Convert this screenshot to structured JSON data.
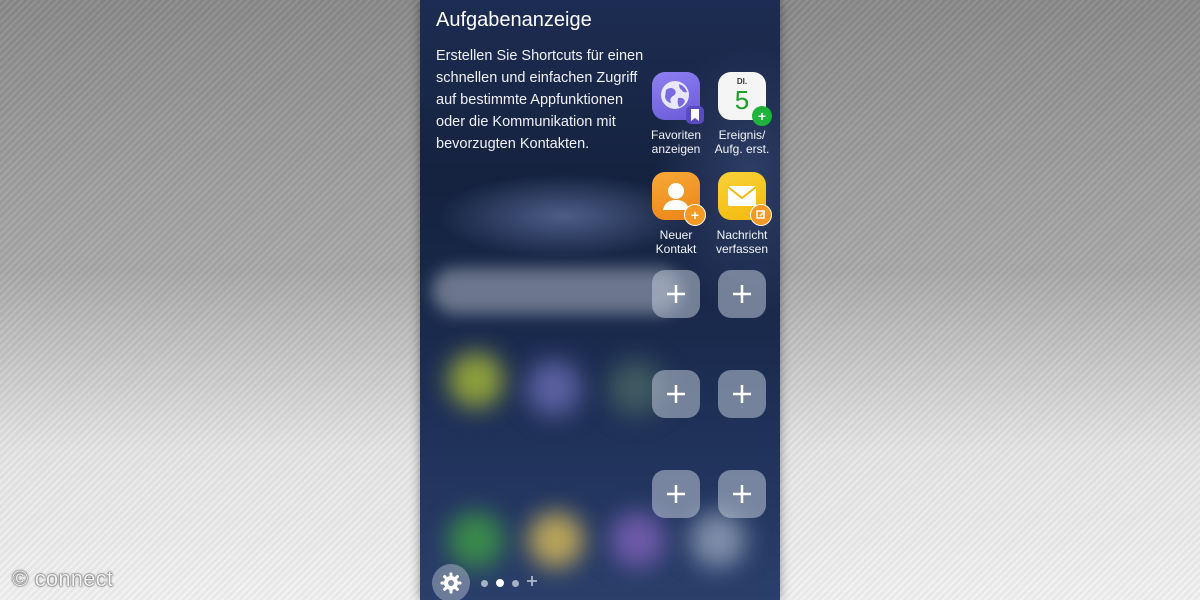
{
  "watermark": "© connect",
  "panel": {
    "title": "Aufgabenanzeige",
    "description": "Erstellen Sie Shortcuts für einen schnellen und einfachen Zugriff auf bestimmte Appfunktionen oder die Kommunikation mit bevorzugten Kontakten."
  },
  "shortcuts": [
    {
      "label": "Favoriten\nanzeigen",
      "icon": "globe-bookmark-icon",
      "color": "#7b6fe6"
    },
    {
      "label": "Ereignis/\nAufg. erst.",
      "icon": "calendar-icon",
      "color": "#f4f4f4",
      "calendar_day": "DI.",
      "calendar_date": "5"
    },
    {
      "label": "Neuer\nKontakt",
      "icon": "contact-icon",
      "color": "#f39a26"
    },
    {
      "label": "Nachricht\nverfassen",
      "icon": "message-icon",
      "color": "#f7c417"
    }
  ],
  "empty_slots": 6,
  "pager": {
    "pages": 3,
    "active_index": 1
  }
}
